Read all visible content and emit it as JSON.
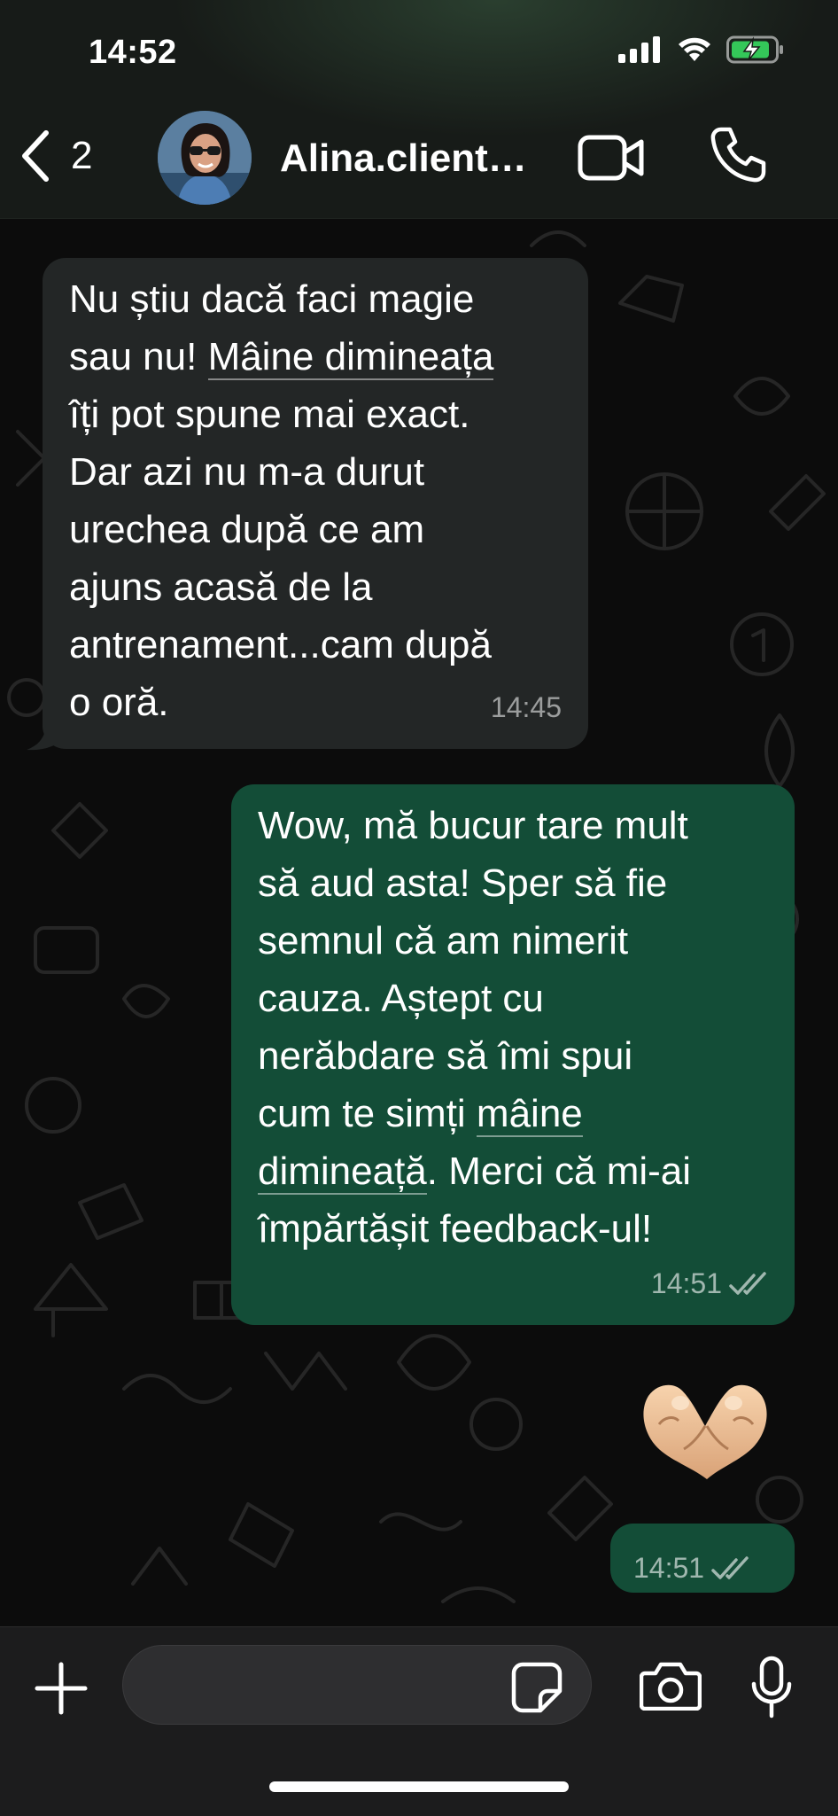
{
  "status_bar": {
    "time": "14:52"
  },
  "header": {
    "back_count": "2",
    "contact_name": "Alina.client…"
  },
  "messages": [
    {
      "direction": "incoming",
      "line1": "Nu știu dacă faci magie\nsau nu! ",
      "underlined": "Mâine dimineața",
      "line2": "\nîți pot spune mai exact.\nDar azi nu m-a durut\nurechea după ce am\najuns acasă de la\nantrenament...cam după\no oră.",
      "time": "14:45"
    },
    {
      "direction": "outgoing",
      "line1": "Wow, mă bucur tare mult\nsă aud asta! Sper să fie\nsemnul că am nimerit\ncauza. Aștept cu\nnerăbdare să îmi spui\ncum te simți ",
      "underlined_a": "mâine",
      "underlined_b": "dimineață",
      "line2": ". Merci că mi-ai\nîmpărtășit feedback-ul!",
      "time": "14:51",
      "status": "read"
    },
    {
      "direction": "outgoing",
      "type": "emoji",
      "emoji": "🫶🏼",
      "time": "14:51",
      "status": "read"
    }
  ],
  "input": {
    "placeholder": ""
  },
  "colors": {
    "incoming_bubble": "#232626",
    "outgoing_bubble": "#134d37",
    "background": "#0c0c0c",
    "battery_green": "#34c759"
  }
}
